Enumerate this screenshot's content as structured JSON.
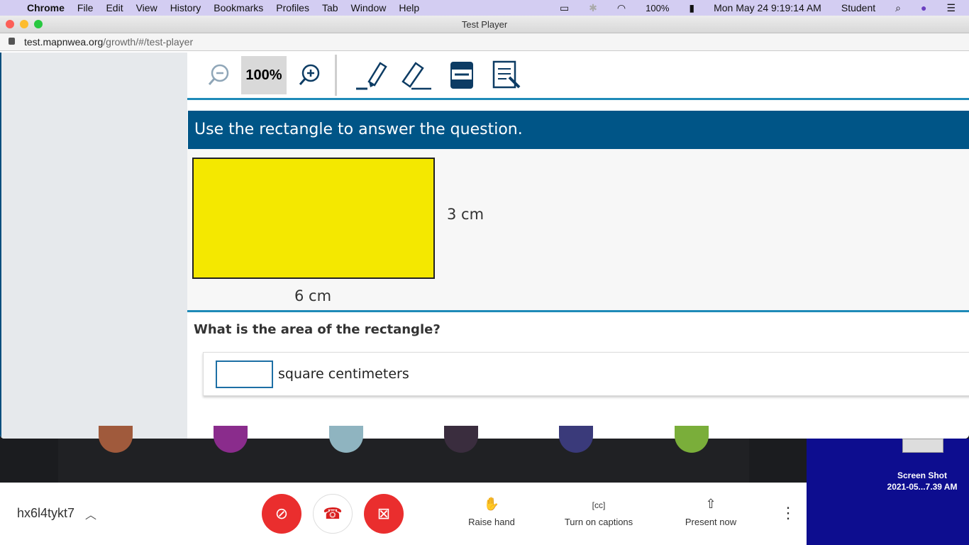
{
  "menubar": {
    "apple": "",
    "items": [
      "Chrome",
      "File",
      "Edit",
      "View",
      "History",
      "Bookmarks",
      "Profiles",
      "Tab",
      "Window",
      "Help"
    ],
    "battery": "100%",
    "datetime": "Mon May 24  9:19:14 AM",
    "user": "Student"
  },
  "window": {
    "title": "Test Player",
    "url_host": "test.mapnwea.org",
    "url_path": "/growth/#/test-player"
  },
  "toolbar": {
    "zoom": "100%"
  },
  "question": {
    "banner": "Use the rectangle to answer the question.",
    "height_label": "3 cm",
    "width_label": "6 cm",
    "prompt": "What is the area of the rectangle?",
    "answer_value": "",
    "unit": "square centimeters"
  },
  "meet": {
    "meeting_code": "hx6l4tykt7",
    "raise_hand": "Raise hand",
    "captions": "Turn on captions",
    "present": "Present now"
  },
  "desktop": {
    "file_name": "Screen Shot",
    "file_date": "2021-05...7.39 AM"
  }
}
